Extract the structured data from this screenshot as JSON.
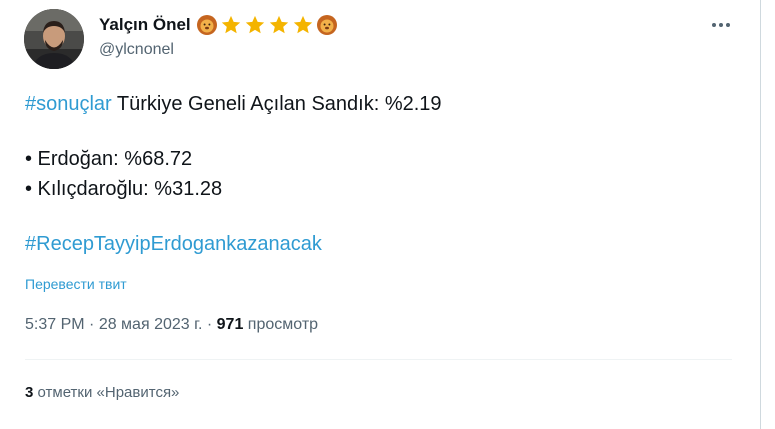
{
  "author": {
    "display_name": "Yalçın Önel",
    "handle": "@ylcnonel",
    "badges": [
      "lion-emoji",
      "star-emoji",
      "star-emoji",
      "star-emoji",
      "star-emoji",
      "lion-emoji"
    ]
  },
  "tweet": {
    "hashtag_1": "#sonuçlar",
    "text_1": " Türkiye Geneli Açılan Sandık: %2.19",
    "line_2": "• Erdoğan: %68.72",
    "line_3": "• Kılıçdaroğlu: %31.28",
    "hashtag_2": "#RecepTayyipErdogankazanacak"
  },
  "translate_label": "Перевести твит",
  "meta": {
    "time": "5:37 PM",
    "separator_1": " · ",
    "date": "28 мая 2023 г.",
    "separator_2": " · ",
    "views_count": "971",
    "views_label": " просмотр"
  },
  "engagement": {
    "likes_count": "3",
    "likes_label": " отметки «Нравится»"
  },
  "colors": {
    "link": "#2f9bd2",
    "secondary_text": "#536471",
    "primary_text": "#0f1419",
    "star": "#f4b400"
  }
}
